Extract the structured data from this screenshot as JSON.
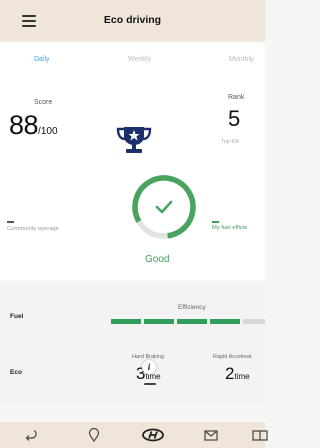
{
  "header": {
    "title": "Eco driving"
  },
  "tabs": [
    "Daily",
    "Weekly",
    "Monthly"
  ],
  "active_tab": "Daily",
  "score": {
    "label": "Score",
    "value": "88",
    "max": "/100"
  },
  "rank": {
    "label": "Rank",
    "value": "5",
    "sub": "Top 5%"
  },
  "gauge": {
    "label": "Good",
    "community_label": "Community average",
    "my_label": "My fuel efficie"
  },
  "fuel": {
    "label": "Fuel",
    "efficiency_label": "Efficiency",
    "efficiency_segments_filled": 4,
    "efficiency_segments_total": 5
  },
  "eco": {
    "label": "Eco",
    "hard_braking": {
      "label": "Hard Braking",
      "value": "3",
      "unit": "time"
    },
    "rapid_accel": {
      "label": "Rapid Accelerat",
      "value": "2",
      "unit": "time"
    }
  },
  "info_button": "i",
  "colors": {
    "accent_blue": "#3aa8e8",
    "eco_green": "#2f9e5a",
    "trophy_navy": "#1c2f6b",
    "header_beige": "#efe6d9"
  },
  "icons": [
    "menu-icon",
    "trophy-icon",
    "info-icon",
    "back-icon",
    "location-icon",
    "brand-logo-icon",
    "mail-icon",
    "book-icon"
  ]
}
